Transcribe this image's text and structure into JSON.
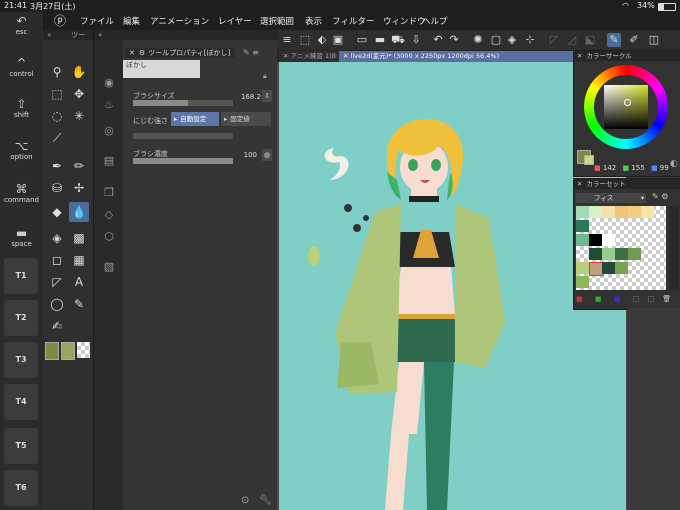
{
  "status": {
    "time": "21:41",
    "date": "3月27日(土)",
    "battery": "34%"
  },
  "menu": [
    "ファイル",
    "編集",
    "アニメーション",
    "レイヤー",
    "選択範囲",
    "表示",
    "フィルター",
    "ウィンドウ",
    "ヘルプ"
  ],
  "keys": {
    "esc": "esc",
    "control": "control",
    "shift": "shift",
    "option": "option",
    "command": "command",
    "space": "space",
    "t": [
      "T1",
      "T2",
      "T3",
      "T4",
      "T5",
      "T6"
    ]
  },
  "toolpanel": {
    "header": "ツー"
  },
  "tool_property": {
    "title": "ツールプロパティ[ぼかし]",
    "subtool_name": "ぼかし",
    "brush_size_label": "ブラシサイズ",
    "brush_size_value": "168.2",
    "brush_size_fill": 0.55,
    "bleed_label": "にじむ強さ",
    "auto_setting": "自動設定",
    "fixed_value": "固定値",
    "density_label": "ブラシ濃度",
    "density_value": "100",
    "density_fill": 1.0
  },
  "tabs": {
    "tab1": "アニメ練習 1(B",
    "tab2": "live2d(変元)* (3000 x 2250px 1200dpi 56.4%)"
  },
  "color_circle": {
    "title": "カラーサークル",
    "r": "142",
    "g": "155",
    "b": "99"
  },
  "color_set": {
    "title": "カラーセット",
    "set_name": "フィス"
  },
  "colors": {
    "canvas_bg": "#7fcfc6",
    "accent_blue": "#4b6d9a",
    "panel": "#323232"
  }
}
